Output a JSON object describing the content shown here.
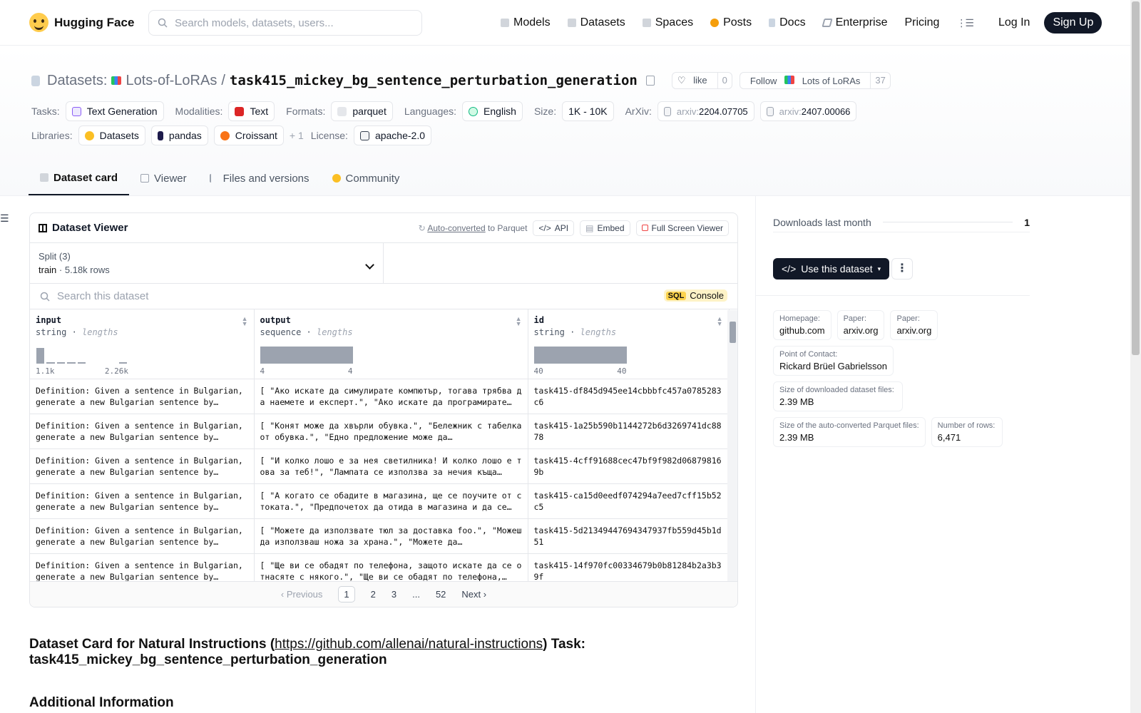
{
  "nav": {
    "logo": "Hugging Face",
    "search_placeholder": "Search models, datasets, users...",
    "links": [
      "Models",
      "Datasets",
      "Spaces",
      "Posts",
      "Docs",
      "Enterprise",
      "Pricing"
    ],
    "login": "Log In",
    "signup": "Sign Up"
  },
  "header": {
    "prefix": "Datasets:",
    "org": "Lots-of-LoRAs",
    "sep": "/",
    "repo": "task415_mickey_bg_sentence_perturbation_generation",
    "like_label": "like",
    "like_count": "0",
    "follow_label": "Follow",
    "follow_org": "Lots of LoRAs",
    "follow_count": "37"
  },
  "meta": {
    "tasks_label": "Tasks:",
    "task": "Text Generation",
    "modalities_label": "Modalities:",
    "modality": "Text",
    "formats_label": "Formats:",
    "format": "parquet",
    "languages_label": "Languages:",
    "language": "English",
    "size_label": "Size:",
    "size": "1K - 10K",
    "arxiv_label": "ArXiv:",
    "arxiv_prefix": "arxiv:",
    "arxiv1": "2204.07705",
    "arxiv2": "2407.00066",
    "libraries_label": "Libraries:",
    "lib1": "Datasets",
    "lib2": "pandas",
    "lib3": "Croissant",
    "lib_more": "+ 1",
    "license_label": "License:",
    "license": "apache-2.0"
  },
  "tabs": [
    "Dataset card",
    "Viewer",
    "Files and versions",
    "Community"
  ],
  "viewer": {
    "title": "Dataset Viewer",
    "auto_converted": "Auto-converted",
    "to_parquet": "to Parquet",
    "api": "API",
    "embed": "Embed",
    "full_screen": "Full Screen Viewer",
    "split_label": "Split (3)",
    "split_value": "train",
    "split_rows": "5.18k rows",
    "search_placeholder": "Search this dataset",
    "sql": "SQL",
    "console": "Console",
    "columns": [
      {
        "name": "input",
        "type": "string",
        "stat": "lengths",
        "min": "1.1k",
        "max": "2.26k"
      },
      {
        "name": "output",
        "type": "sequence",
        "stat": "lengths",
        "min": "4",
        "max": "4"
      },
      {
        "name": "id",
        "type": "string",
        "stat": "lengths",
        "min": "40",
        "max": "40"
      }
    ],
    "input_hist": [
      0.9,
      0.08,
      0.08,
      0.08,
      0.08,
      0.0,
      0.0,
      0.0,
      0.08
    ],
    "rows": [
      {
        "input": "Definition: Given a sentence in Bulgarian, generate a new Bulgarian sentence by…",
        "output": "[ \"Ако искате да симулирате компютър, тогава трябва да наемете и експерт.\", \"Ако искате да програмирате…",
        "id": "task415-df845d945ee14cbbbfc457a0785283c6"
      },
      {
        "input": "Definition: Given a sentence in Bulgarian, generate a new Bulgarian sentence by…",
        "output": "[ \"Конят може да хвърли обувка.\", \"Бележник с табелка от обувка.\", \"Едно предложение може да…",
        "id": "task415-1a25b590b1144272b6d3269741dc8878"
      },
      {
        "input": "Definition: Given a sentence in Bulgarian, generate a new Bulgarian sentence by…",
        "output": "[ \"И колко лошо е за нея светилника! И колко лошо е това за теб!\", \"Лампата се използва за нечия къща…",
        "id": "task415-4cff91688cec47bf9f982d068798169b"
      },
      {
        "input": "Definition: Given a sentence in Bulgarian, generate a new Bulgarian sentence by…",
        "output": "[ \"А когато се обадите в магазина, ще се поучите от стоката.\", \"Предпочетох да отида в магазина и да се…",
        "id": "task415-ca15d0eedf074294a7eed7cff15b52c5"
      },
      {
        "input": "Definition: Given a sentence in Bulgarian, generate a new Bulgarian sentence by…",
        "output": "[ \"Можете да използвате тюл за доставка foo.\", \"Можеш да използваш ножа за храна.\", \"Можете да…",
        "id": "task415-5d21349447694347937fb559d45b1d51"
      },
      {
        "input": "Definition: Given a sentence in Bulgarian, generate a new Bulgarian sentence by…",
        "output": "[ \"Ще ви се обадят по телефона, защото искате да се отнасяте с някого.\", \"Ще ви се обадят по телефона,…",
        "id": "task415-14f970fc00334679b0b81284b2a3b39f"
      }
    ],
    "pager": {
      "prev": "Previous",
      "pages": [
        "1",
        "2",
        "3",
        "...",
        "52"
      ],
      "next": "Next"
    }
  },
  "card": {
    "title_start": "Dataset Card for Natural Instructions (",
    "link": "https://github.com/allenai/natural-instructions",
    "title_end": ") Task:",
    "task_name": "task415_mickey_bg_sentence_perturbation_generation",
    "additional": "Additional Information"
  },
  "side": {
    "downloads_label": "Downloads last month",
    "downloads": "1",
    "use_button": "Use this dataset",
    "info": [
      {
        "k": "Homepage:",
        "v": "github.com"
      },
      {
        "k": "Paper:",
        "v": "arxiv.org"
      },
      {
        "k": "Paper:",
        "v": "arxiv.org"
      },
      {
        "k": "Point of Contact:",
        "v": "Rickard Brüel Gabrielsson"
      },
      {
        "k": "Size of downloaded dataset files:",
        "v": "2.39 MB"
      },
      {
        "k": "Size of the auto-converted Parquet files:",
        "v": "2.39 MB"
      },
      {
        "k": "Number of rows:",
        "v": "6,471"
      }
    ]
  }
}
